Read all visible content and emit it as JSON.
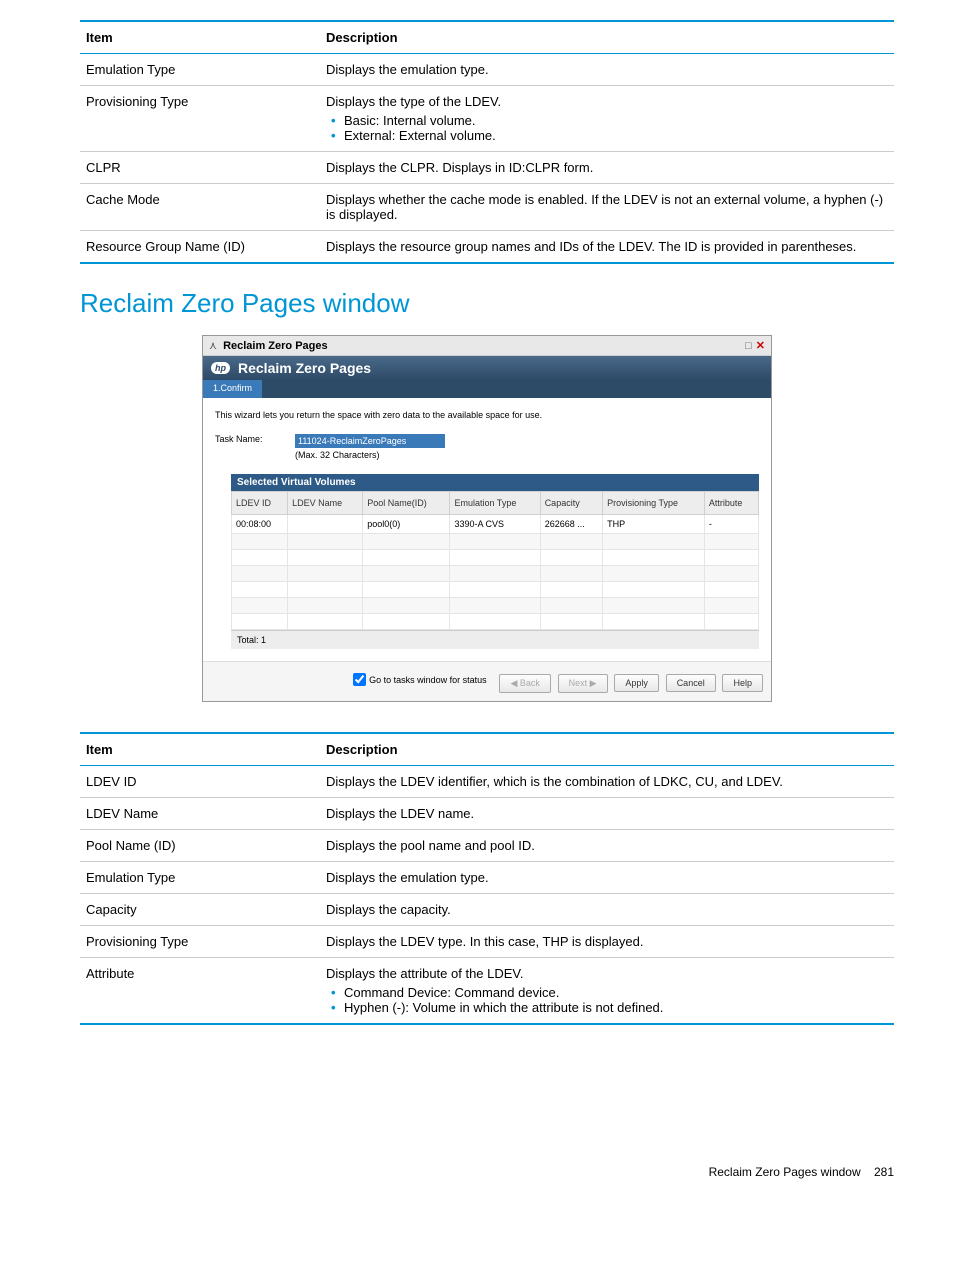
{
  "table1": {
    "headers": {
      "item": "Item",
      "desc": "Description"
    },
    "rows": [
      {
        "item": "Emulation Type",
        "desc": "Displays the emulation type."
      },
      {
        "item": "Provisioning Type",
        "desc": "Displays the type of the LDEV.",
        "bullets": [
          "Basic: Internal volume.",
          "External: External volume."
        ]
      },
      {
        "item": "CLPR",
        "desc": "Displays the CLPR. Displays in ID:CLPR form."
      },
      {
        "item": "Cache Mode",
        "desc": "Displays whether the cache mode is enabled. If the LDEV is not an external volume, a hyphen (-) is displayed."
      },
      {
        "item": "Resource Group Name (ID)",
        "desc": "Displays the resource group names and IDs of the LDEV. The ID is provided in parentheses."
      }
    ]
  },
  "section_title": "Reclaim Zero Pages window",
  "wizard": {
    "titlebar": "Reclaim Zero Pages",
    "banner_logo": "hp",
    "banner_title": "Reclaim Zero Pages",
    "tab": "1.Confirm",
    "description": "This wizard lets you return the space with zero data to the available space for use.",
    "task_label": "Task Name:",
    "task_value": "111024-ReclaimZeroPages",
    "task_hint": "(Max. 32 Characters)",
    "grid_title": "Selected Virtual Volumes",
    "grid_headers": {
      "ldev_id": "LDEV ID",
      "ldev_name": "LDEV Name",
      "pool": "Pool Name(ID)",
      "emu": "Emulation Type",
      "cap": "Capacity",
      "prov": "Provisioning Type",
      "attr": "Attribute"
    },
    "grid_row": {
      "ldev_id": "00:08:00",
      "ldev_name": "",
      "pool": "pool0(0)",
      "emu": "3390-A CVS",
      "cap": "262668 ...",
      "prov": "THP",
      "attr": "-"
    },
    "grid_total": "Total: 1",
    "checkbox_label": "Go to tasks window for status",
    "buttons": {
      "back": "◀ Back",
      "next": "Next ▶",
      "apply": "Apply",
      "cancel": "Cancel",
      "help": "Help"
    }
  },
  "table2": {
    "headers": {
      "item": "Item",
      "desc": "Description"
    },
    "rows": [
      {
        "item": "LDEV ID",
        "desc": "Displays the LDEV identifier, which is the combination of LDKC, CU, and LDEV."
      },
      {
        "item": "LDEV Name",
        "desc": "Displays the LDEV name."
      },
      {
        "item": "Pool Name (ID)",
        "desc": "Displays the pool name and pool ID."
      },
      {
        "item": "Emulation Type",
        "desc": "Displays the emulation type."
      },
      {
        "item": "Capacity",
        "desc": "Displays the capacity."
      },
      {
        "item": "Provisioning Type",
        "desc": "Displays the LDEV type. In this case, THP is displayed."
      },
      {
        "item": "Attribute",
        "desc": "Displays the attribute of the LDEV.",
        "bullets": [
          "Command Device: Command device.",
          "Hyphen (-): Volume in which the attribute is not defined."
        ]
      }
    ]
  },
  "footer": {
    "text": "Reclaim Zero Pages window",
    "page": "281"
  }
}
